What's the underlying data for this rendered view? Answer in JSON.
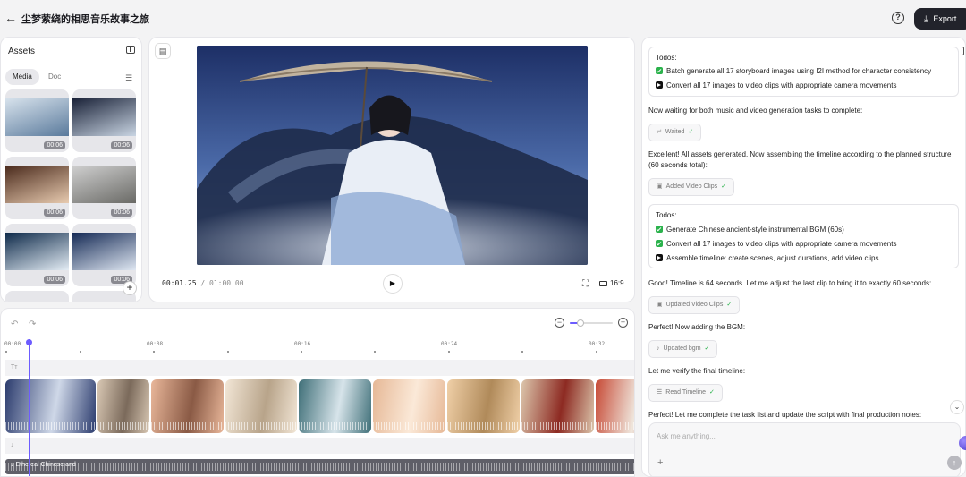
{
  "header": {
    "title": "尘梦萦绕的相思音乐故事之旅",
    "back_icon": "←",
    "help_icon": "?",
    "export_label": "Export",
    "export_icon": "⤓"
  },
  "assets": {
    "title": "Assets",
    "tabs": [
      "Media",
      "Doc"
    ],
    "items": [
      {
        "duration": "00:06",
        "c1": "#d7e2ec",
        "c2": "#5a7a9c"
      },
      {
        "duration": "00:06",
        "c1": "#1a2238",
        "c2": "#c9d5e3"
      },
      {
        "duration": "00:06",
        "c1": "#4a2a1c",
        "c2": "#e8cbb0"
      },
      {
        "duration": "00:06",
        "c1": "#cfcfcf",
        "c2": "#6a6a66"
      },
      {
        "duration": "00:06",
        "c1": "#0e2a4a",
        "c2": "#e4edf5"
      },
      {
        "duration": "00:06",
        "c1": "#152a55",
        "c2": "#dfe7f2"
      }
    ],
    "add_label": "+"
  },
  "preview": {
    "current_time": "00:01.25",
    "total_time": "/ 01:00.00",
    "aspect_ratio": "16:9",
    "play_icon": "▶",
    "fullscreen_icon": "⛶"
  },
  "timeline": {
    "undo_icon": "↶",
    "redo_icon": "↷",
    "zoom_level": 0.25,
    "ruler": [
      "00:00",
      "00:08",
      "00:16",
      "00:24",
      "00:32"
    ],
    "text_track_icon": "Tт",
    "audio_track_icon": "♪",
    "audio_label": "Ethereal Chinese and",
    "clips": [
      {
        "c1": "#2c3c6e",
        "c2": "#cfd8e8"
      },
      {
        "c1": "#d9c8b4",
        "c2": "#7b6a5b"
      },
      {
        "c1": "#e9b79a",
        "c2": "#8a5a45"
      },
      {
        "c1": "#f2e6d6",
        "c2": "#b8a48a"
      },
      {
        "c1": "#3f6f78",
        "c2": "#d7e4ea"
      },
      {
        "c1": "#e6b896",
        "c2": "#fbe9d8"
      },
      {
        "c1": "#f0d0a8",
        "c2": "#b08a5a"
      },
      {
        "c1": "#dcc6ac",
        "c2": "#8d2a22"
      },
      {
        "c1": "#c74a36",
        "c2": "#efe6dc"
      },
      {
        "c1": "#e9e6e0",
        "c2": "#6b6258"
      }
    ]
  },
  "chat": {
    "todo1": {
      "title": "Todos:",
      "items": [
        {
          "state": "done",
          "text": "Batch generate all 17 storyboard images using I2I method for character consistency"
        },
        {
          "state": "current",
          "text": "Convert all 17 images to video clips with appropriate camera movements"
        }
      ]
    },
    "msg1": "Now waiting for both music and video generation tasks to complete:",
    "chip1": {
      "icon": "≓",
      "label": "Waited"
    },
    "msg2": "Excellent! All assets generated. Now assembling the timeline according to the planned structure (60 seconds total):",
    "chip2": {
      "icon": "▣",
      "label": "Added Video Clips"
    },
    "todo2": {
      "title": "Todos:",
      "items": [
        {
          "state": "done",
          "text": "Generate Chinese ancient-style instrumental BGM (60s)"
        },
        {
          "state": "done",
          "text": "Convert all 17 images to video clips with appropriate camera movements"
        },
        {
          "state": "current",
          "text": "Assemble timeline: create scenes, adjust durations, add video clips"
        }
      ]
    },
    "msg3": "Good! Timeline is 64 seconds. Let me adjust the last clip to bring it to exactly 60 seconds:",
    "chip3": {
      "icon": "▣",
      "label": "Updated Video Clips"
    },
    "msg4": "Perfect! Now adding the BGM:",
    "chip4": {
      "icon": "♪",
      "label": "Updated bgm"
    },
    "msg5": "Let me verify the final timeline:",
    "chip5": {
      "icon": "☰",
      "label": "Read Timeline"
    },
    "msg6": "Perfect! Let me complete the task list and update the script with final production notes:",
    "check_icon": "✓",
    "composer_placeholder": "Ask me anything...",
    "scroll_icon": "⌄",
    "send_icon": "↑",
    "plus_icon": "+"
  }
}
